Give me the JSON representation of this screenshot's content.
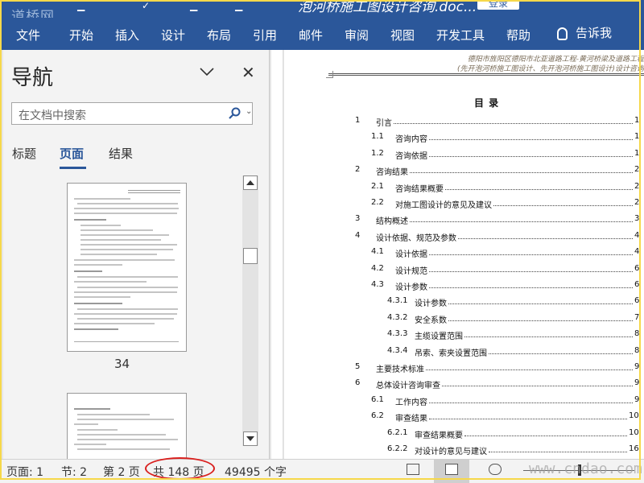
{
  "titlebar": {
    "watermark": "道桥网",
    "doc_title": "泡河桥施工图设计咨询.doc...",
    "login_label": "登录"
  },
  "ribbon": {
    "tabs": [
      "文件",
      "开始",
      "插入",
      "设计",
      "布局",
      "引用",
      "邮件",
      "审阅",
      "视图",
      "开发工具",
      "帮助"
    ],
    "tell_me": "告诉我"
  },
  "nav": {
    "title": "导航",
    "search_placeholder": "在文档中搜索",
    "tabs": [
      "标题",
      "页面",
      "结果"
    ],
    "active_tab": "页面",
    "thumb_page_number": "34"
  },
  "document": {
    "header_line1": "德阳市旌阳区德阳市北亚道路工程-黄河桥梁及道路工程",
    "header_line2": "(先开泡河桥施工图设计、先开泡河桥施工图设计)设计咨询",
    "toc_title": "目 录",
    "toc": [
      {
        "num": "1",
        "title": "引言",
        "page": "1",
        "level": 1
      },
      {
        "num": "1.1",
        "title": "咨询内容",
        "page": "1",
        "level": 2
      },
      {
        "num": "1.2",
        "title": "咨询依据",
        "page": "1",
        "level": 2
      },
      {
        "num": "2",
        "title": "咨询结果",
        "page": "2",
        "level": 1
      },
      {
        "num": "2.1",
        "title": "咨询结果概要",
        "page": "2",
        "level": 2
      },
      {
        "num": "2.2",
        "title": "对施工图设计的意见及建议",
        "page": "2",
        "level": 2
      },
      {
        "num": "3",
        "title": "结构概述",
        "page": "3",
        "level": 1
      },
      {
        "num": "4",
        "title": "设计依据、规范及参数",
        "page": "4",
        "level": 1
      },
      {
        "num": "4.1",
        "title": "设计依据",
        "page": "4",
        "level": 2
      },
      {
        "num": "4.2",
        "title": "设计规范",
        "page": "6",
        "level": 2
      },
      {
        "num": "4.3",
        "title": "设计参数",
        "page": "6",
        "level": 2
      },
      {
        "num": "4.3.1",
        "title": "设计参数",
        "page": "6",
        "level": 3
      },
      {
        "num": "4.3.2",
        "title": "安全系数",
        "page": "7",
        "level": 3
      },
      {
        "num": "4.3.3",
        "title": "主缆设置范围",
        "page": "8",
        "level": 3
      },
      {
        "num": "4.3.4",
        "title": "吊索、索夹设置范围",
        "page": "8",
        "level": 3
      },
      {
        "num": "5",
        "title": "主要技术标准",
        "page": "9",
        "level": 1
      },
      {
        "num": "6",
        "title": "总体设计咨询审查",
        "page": "9",
        "level": 1
      },
      {
        "num": "6.1",
        "title": "工作内容",
        "page": "9",
        "level": 2
      },
      {
        "num": "6.2",
        "title": "审查结果",
        "page": "10",
        "level": 2
      },
      {
        "num": "6.2.1",
        "title": "审查结果概要",
        "page": "10",
        "level": 3
      },
      {
        "num": "6.2.2",
        "title": "对设计的意见与建议",
        "page": "16",
        "level": 3
      }
    ]
  },
  "status": {
    "page": "页面: 1",
    "section": "节: 2",
    "page_of": "第 2 页",
    "total_pages": "共 148 页",
    "word_count": "49495 个字",
    "site_watermark": "www.cndao.com"
  }
}
